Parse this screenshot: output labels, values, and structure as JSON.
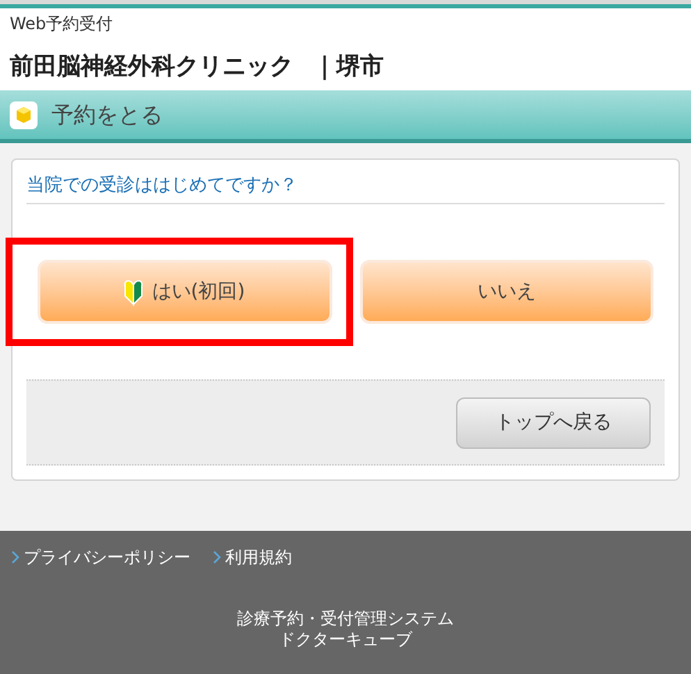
{
  "header": {
    "subtitle": "Web予約受付",
    "clinic": "前田脳神経外科クリニック",
    "city": "｜堺市"
  },
  "section_title": "予約をとる",
  "question": "当院での受診ははじめてですか？",
  "answers": [
    {
      "label": "はい(初回)",
      "kind": "first",
      "highlighted": true
    },
    {
      "label": "いいえ",
      "kind": "plain",
      "highlighted": false
    }
  ],
  "back_button": "トップへ戻る",
  "footer": {
    "links": [
      "プライバシーポリシー",
      "利用規約"
    ],
    "system": [
      "診療予約・受付管理システム",
      "ドクターキューブ"
    ]
  }
}
